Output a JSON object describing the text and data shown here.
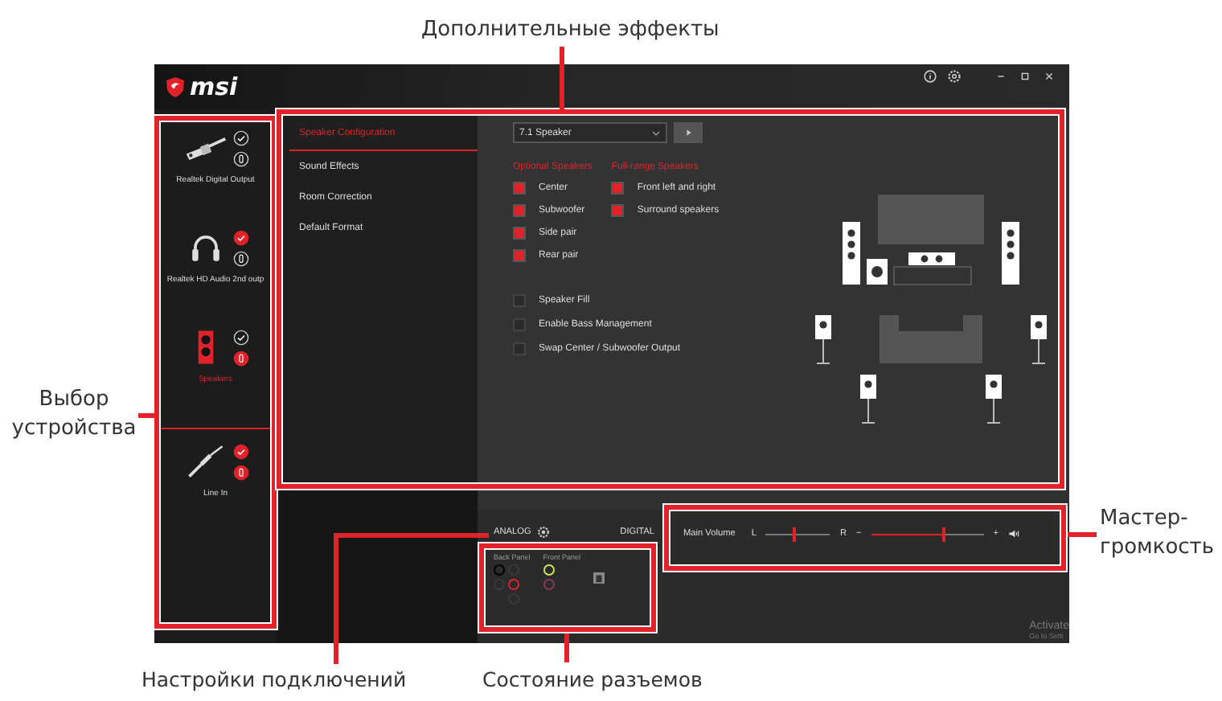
{
  "callouts": {
    "effects": "Дополнительные эффекты",
    "device_select": "Выбор устройства",
    "master_volume": "Мастер-громкость",
    "connection_settings": "Настройки подключений",
    "jack_status": "Состояние разъемов"
  },
  "window": {
    "logo": "msi"
  },
  "devices": [
    {
      "name": "Realtek Digital Output",
      "kind": "digital",
      "selected": false,
      "default": false,
      "communication": false
    },
    {
      "name": "Realtek HD Audio 2nd outp",
      "kind": "headphones",
      "selected": false,
      "default": true,
      "communication": false
    },
    {
      "name": "Speakers",
      "kind": "speakers",
      "selected": true,
      "default": false,
      "communication": true
    },
    {
      "name": "Line In",
      "kind": "line-in",
      "selected": false,
      "default": true,
      "communication": true
    }
  ],
  "tabs": [
    {
      "label": "Speaker Configuration",
      "selected": true
    },
    {
      "label": "Sound Effects",
      "selected": false
    },
    {
      "label": "Room Correction",
      "selected": false
    },
    {
      "label": "Default Format",
      "selected": false
    }
  ],
  "speaker_setup": {
    "value": "7.1 Speaker"
  },
  "optional_speakers": {
    "title": "Optional Speakers",
    "items": [
      {
        "label": "Center",
        "checked": true
      },
      {
        "label": "Subwoofer",
        "checked": true
      },
      {
        "label": "Side pair",
        "checked": true
      },
      {
        "label": "Rear pair",
        "checked": true
      }
    ]
  },
  "full_range_speakers": {
    "title": "Full-range Speakers",
    "items": [
      {
        "label": "Front left and right",
        "checked": true
      },
      {
        "label": "Surround speakers",
        "checked": true
      }
    ]
  },
  "options": [
    {
      "label": "Speaker Fill",
      "checked": false
    },
    {
      "label": "Enable Bass Management",
      "checked": false
    },
    {
      "label": "Swap Center / Subwoofer Output",
      "checked": false
    }
  ],
  "connection": {
    "analog": "ANALOG",
    "digital": "DIGITAL",
    "back_panel": {
      "title": "Back Panel",
      "columns": [
        [
          {
            "color": "#000000"
          },
          {
            "color": "#3a3a3a"
          }
        ],
        [
          {
            "color": "#3a3a3a"
          },
          {
            "color": "#e0222a"
          },
          {
            "color": "#3a3a3a"
          }
        ]
      ]
    },
    "front_panel": {
      "title": "Front Panel",
      "columns": [
        [
          {
            "color": "#c8e65a"
          },
          {
            "color": "#8a3a55"
          }
        ]
      ]
    }
  },
  "volume": {
    "label": "Main Volume",
    "left": "L",
    "right": "R",
    "balance": {
      "level": 0.45
    },
    "minus": "−",
    "plus": "+",
    "main": {
      "level": 0.65
    }
  },
  "watermark": {
    "title": "Activate",
    "subtitle": "Go to Setti"
  }
}
